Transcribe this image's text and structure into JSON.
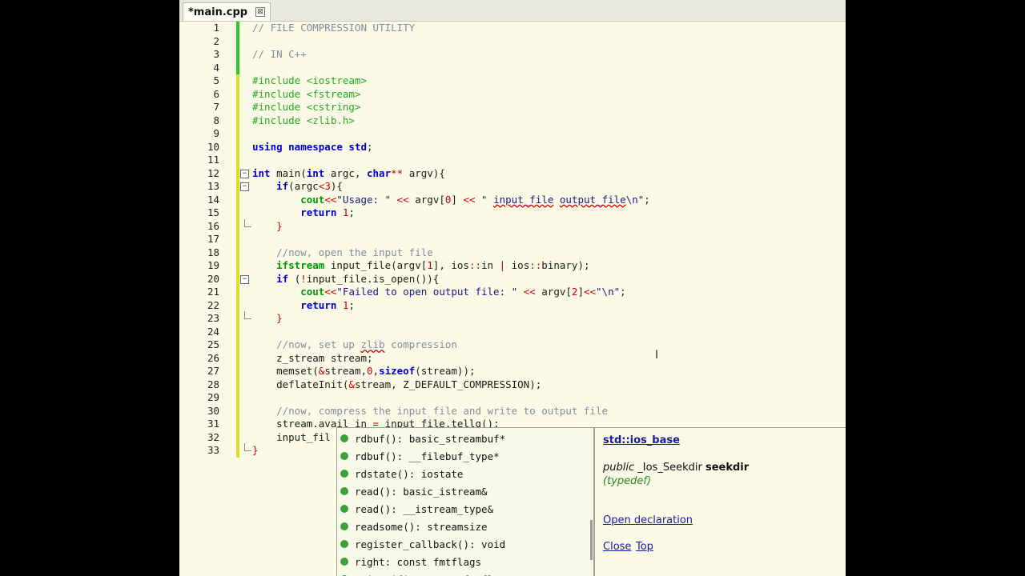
{
  "tab": {
    "title": "*main.cpp",
    "close": "⊠"
  },
  "lines": [
    {
      "n": "1",
      "bar": "#22cc22",
      "fold": "",
      "segs": [
        {
          "t": "// FILE COMPRESSION UTILITY",
          "c": "cm"
        }
      ]
    },
    {
      "n": "2",
      "bar": "#22cc22",
      "fold": "",
      "segs": []
    },
    {
      "n": "3",
      "bar": "#22cc22",
      "fold": "",
      "segs": [
        {
          "t": "// IN C++",
          "c": "cm"
        }
      ]
    },
    {
      "n": "4",
      "bar": "#22cc22",
      "fold": "",
      "segs": []
    },
    {
      "n": "5",
      "bar": "#dddd22",
      "fold": "",
      "segs": [
        {
          "t": "#include <iostream>",
          "c": "pp"
        }
      ]
    },
    {
      "n": "6",
      "bar": "#dddd22",
      "fold": "",
      "segs": [
        {
          "t": "#include <fstream>",
          "c": "pp"
        }
      ]
    },
    {
      "n": "7",
      "bar": "#dddd22",
      "fold": "",
      "segs": [
        {
          "t": "#include <cstring>",
          "c": "pp"
        }
      ]
    },
    {
      "n": "8",
      "bar": "#dddd22",
      "fold": "",
      "segs": [
        {
          "t": "#include <zlib.h>",
          "c": "pp"
        }
      ]
    },
    {
      "n": "9",
      "bar": "#dddd22",
      "fold": "",
      "segs": []
    },
    {
      "n": "10",
      "bar": "#dddd22",
      "fold": "",
      "segs": [
        {
          "t": "using namespace ",
          "c": "kw"
        },
        {
          "t": "std",
          "c": "kw"
        },
        {
          "t": ";",
          "c": "pn"
        }
      ]
    },
    {
      "n": "11",
      "bar": "#dddd22",
      "fold": "",
      "segs": []
    },
    {
      "n": "12",
      "bar": "#dddd22",
      "fold": "open",
      "segs": [
        {
          "t": "int",
          "c": "ty"
        },
        {
          "t": " main(",
          "c": "pn"
        },
        {
          "t": "int",
          "c": "ty"
        },
        {
          "t": " argc, ",
          "c": "pn"
        },
        {
          "t": "char",
          "c": "ty"
        },
        {
          "t": "**",
          "c": "op"
        },
        {
          "t": " argv){",
          "c": "pn"
        }
      ]
    },
    {
      "n": "13",
      "bar": "#dddd22",
      "fold": "open",
      "segs": [
        {
          "t": "    ",
          "c": "pn"
        },
        {
          "t": "if",
          "c": "kw"
        },
        {
          "t": "(argc",
          "c": "pn"
        },
        {
          "t": "<",
          "c": "op"
        },
        {
          "t": "3",
          "c": "num"
        },
        {
          "t": "){",
          "c": "pn"
        }
      ]
    },
    {
      "n": "14",
      "bar": "#dddd22",
      "fold": "",
      "segs": [
        {
          "t": "        ",
          "c": "pn"
        },
        {
          "t": "cout",
          "c": "gr"
        },
        {
          "t": "<<",
          "c": "op"
        },
        {
          "t": "\"Usage: \" ",
          "c": "str"
        },
        {
          "t": "<<",
          "c": "op"
        },
        {
          "t": " argv[",
          "c": "pn"
        },
        {
          "t": "0",
          "c": "num"
        },
        {
          "t": "] ",
          "c": "pn"
        },
        {
          "t": "<<",
          "c": "op"
        },
        {
          "t": " \" ",
          "c": "str"
        },
        {
          "t": "input_file",
          "c": "str err"
        },
        {
          "t": " ",
          "c": "str"
        },
        {
          "t": "output_file",
          "c": "str err"
        },
        {
          "t": "\\n\"",
          "c": "str"
        },
        {
          "t": ";",
          "c": "pn"
        }
      ]
    },
    {
      "n": "15",
      "bar": "#dddd22",
      "fold": "",
      "segs": [
        {
          "t": "        ",
          "c": "pn"
        },
        {
          "t": "return",
          "c": "kw"
        },
        {
          "t": " ",
          "c": "pn"
        },
        {
          "t": "1",
          "c": "num"
        },
        {
          "t": ";",
          "c": "pn"
        }
      ]
    },
    {
      "n": "16",
      "bar": "#dddd22",
      "fold": "end",
      "segs": [
        {
          "t": "    ",
          "c": "pn"
        },
        {
          "t": "}",
          "c": "op"
        }
      ]
    },
    {
      "n": "17",
      "bar": "#dddd22",
      "fold": "",
      "segs": []
    },
    {
      "n": "18",
      "bar": "#dddd22",
      "fold": "",
      "segs": [
        {
          "t": "    //now, open the input file",
          "c": "cm"
        }
      ]
    },
    {
      "n": "19",
      "bar": "#dddd22",
      "fold": "",
      "segs": [
        {
          "t": "    ",
          "c": "pn"
        },
        {
          "t": "ifstream",
          "c": "gr"
        },
        {
          "t": " input_file(argv[",
          "c": "pn"
        },
        {
          "t": "1",
          "c": "num"
        },
        {
          "t": "], ios",
          "c": "pn"
        },
        {
          "t": "::",
          "c": "op"
        },
        {
          "t": "in ",
          "c": "pn"
        },
        {
          "t": "|",
          "c": "op"
        },
        {
          "t": " ios",
          "c": "pn"
        },
        {
          "t": "::",
          "c": "op"
        },
        {
          "t": "binary);",
          "c": "pn"
        }
      ]
    },
    {
      "n": "20",
      "bar": "#dddd22",
      "fold": "open",
      "segs": [
        {
          "t": "    ",
          "c": "pn"
        },
        {
          "t": "if",
          "c": "kw"
        },
        {
          "t": " (",
          "c": "pn"
        },
        {
          "t": "!",
          "c": "op"
        },
        {
          "t": "input_file.is_open()){",
          "c": "pn"
        }
      ]
    },
    {
      "n": "21",
      "bar": "#dddd22",
      "fold": "",
      "segs": [
        {
          "t": "        ",
          "c": "pn"
        },
        {
          "t": "cout",
          "c": "gr"
        },
        {
          "t": "<<",
          "c": "op"
        },
        {
          "t": "\"Failed to open output file: \" ",
          "c": "str"
        },
        {
          "t": "<<",
          "c": "op"
        },
        {
          "t": " argv[",
          "c": "pn"
        },
        {
          "t": "2",
          "c": "num"
        },
        {
          "t": "]",
          "c": "pn"
        },
        {
          "t": "<<",
          "c": "op"
        },
        {
          "t": "\"\\n\"",
          "c": "str"
        },
        {
          "t": ";",
          "c": "pn"
        }
      ]
    },
    {
      "n": "22",
      "bar": "#dddd22",
      "fold": "",
      "segs": [
        {
          "t": "        ",
          "c": "pn"
        },
        {
          "t": "return",
          "c": "kw"
        },
        {
          "t": " ",
          "c": "pn"
        },
        {
          "t": "1",
          "c": "num"
        },
        {
          "t": ";",
          "c": "pn"
        }
      ]
    },
    {
      "n": "23",
      "bar": "#dddd22",
      "fold": "end",
      "segs": [
        {
          "t": "    ",
          "c": "pn"
        },
        {
          "t": "}",
          "c": "op"
        }
      ]
    },
    {
      "n": "24",
      "bar": "#dddd22",
      "fold": "",
      "segs": []
    },
    {
      "n": "25",
      "bar": "#dddd22",
      "fold": "",
      "segs": [
        {
          "t": "    //now, set up ",
          "c": "cm"
        },
        {
          "t": "zlib",
          "c": "cm err"
        },
        {
          "t": " compression",
          "c": "cm"
        }
      ]
    },
    {
      "n": "26",
      "bar": "#dddd22",
      "fold": "",
      "segs": [
        {
          "t": "    z_stream stream;",
          "c": "pn"
        }
      ]
    },
    {
      "n": "27",
      "bar": "#dddd22",
      "fold": "",
      "segs": [
        {
          "t": "    memset(",
          "c": "pn"
        },
        {
          "t": "&",
          "c": "op"
        },
        {
          "t": "stream,",
          "c": "pn"
        },
        {
          "t": "0",
          "c": "num"
        },
        {
          "t": ",",
          "c": "pn"
        },
        {
          "t": "sizeof",
          "c": "kw"
        },
        {
          "t": "(stream));",
          "c": "pn"
        }
      ]
    },
    {
      "n": "28",
      "bar": "#dddd22",
      "fold": "",
      "segs": [
        {
          "t": "    deflateInit(",
          "c": "pn"
        },
        {
          "t": "&",
          "c": "op"
        },
        {
          "t": "stream, Z_DEFAULT_COMPRESSION);",
          "c": "pn"
        }
      ]
    },
    {
      "n": "29",
      "bar": "#dddd22",
      "fold": "",
      "segs": []
    },
    {
      "n": "30",
      "bar": "#dddd22",
      "fold": "",
      "segs": [
        {
          "t": "    //now, compress the input file and write to output file",
          "c": "cm"
        }
      ]
    },
    {
      "n": "31",
      "bar": "#dddd22",
      "fold": "",
      "segs": [
        {
          "t": "    stream.avail_in ",
          "c": "pn"
        },
        {
          "t": "=",
          "c": "op"
        },
        {
          "t": " input_file.tellg();",
          "c": "pn"
        }
      ]
    },
    {
      "n": "32",
      "bar": "#dddd22",
      "fold": "",
      "segs": [
        {
          "t": "    input_fil",
          "c": "pn"
        }
      ]
    },
    {
      "n": "33",
      "bar": "#dddd22",
      "fold": "end",
      "segs": [
        {
          "t": "}",
          "c": "op"
        }
      ]
    }
  ],
  "autocomplete": [
    "rdbuf(): basic_streambuf*",
    "rdbuf(): __filebuf_type*",
    "rdstate(): iostate",
    "read(): basic_istream&",
    "read(): __istream_type&",
    "readsome(): streamsize",
    "register_callback(): void",
    "right: const fmtflags",
    "scientific: const fmtflags"
  ],
  "doc": {
    "title": "std::ios_base",
    "visibility": "public",
    "type": "_Ios_Seekdir",
    "name": "seekdir",
    "kind": "(typedef)",
    "open_declaration": "Open declaration",
    "close": "Close",
    "top": "Top"
  },
  "cursor": "I"
}
